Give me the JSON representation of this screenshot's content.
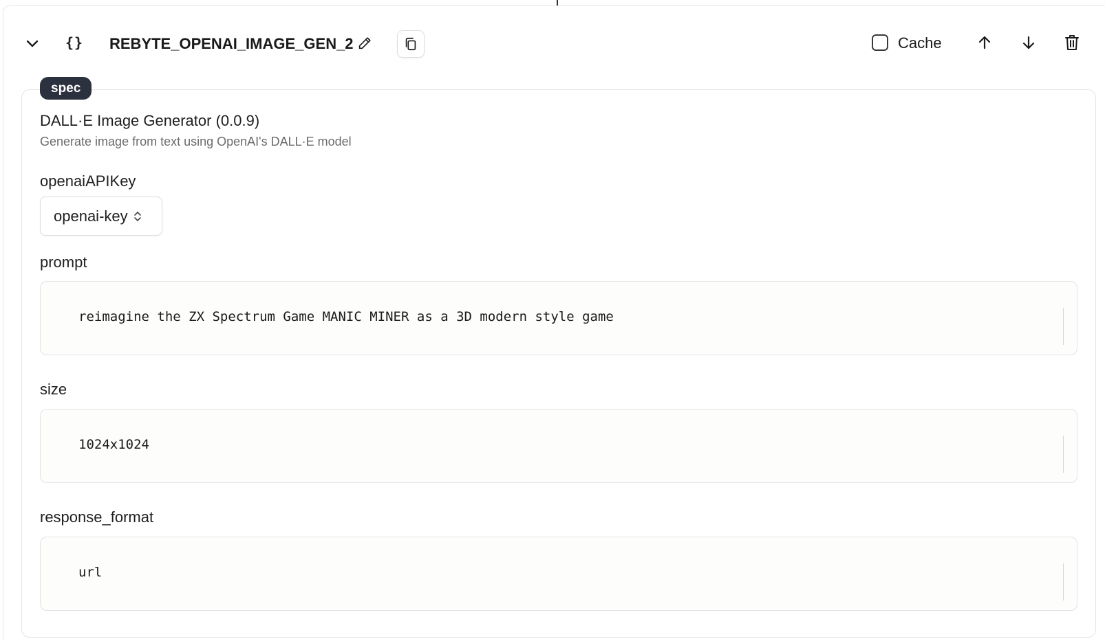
{
  "node": {
    "title": "REBYTE_OPENAI_IMAGE_GEN_2",
    "cache_label": "Cache",
    "cache_checked": false,
    "icons": {
      "collapse": "chevron-down-icon",
      "type": "braces-icon",
      "type_glyph": "{}",
      "edit": "pencil-icon",
      "copy": "copy-icon",
      "move_up": "arrow-up-icon",
      "move_down": "arrow-down-icon",
      "delete": "trash-icon"
    }
  },
  "spec": {
    "badge": "spec",
    "plugin_name": "DALL·E Image Generator (0.0.9)",
    "plugin_description": "Generate image from text using OpenAI's DALL·E model",
    "fields": {
      "openaiAPIKey": {
        "label": "openaiAPIKey",
        "value": "openai-key"
      },
      "prompt": {
        "label": "prompt",
        "value": "reimagine the ZX Spectrum Game MANIC MINER as a 3D modern style game"
      },
      "size": {
        "label": "size",
        "value": "1024x1024"
      },
      "response_format": {
        "label": "response_format",
        "value": "url"
      }
    }
  }
}
